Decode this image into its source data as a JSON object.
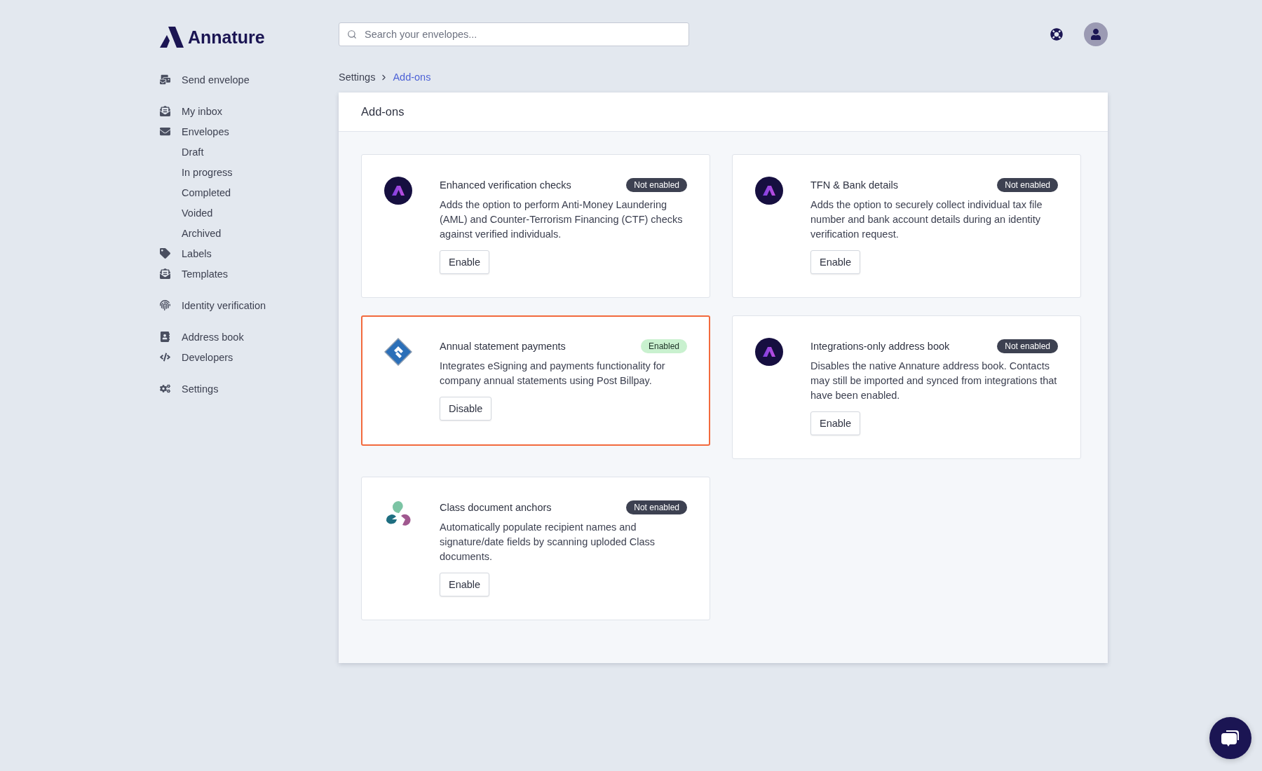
{
  "brand": {
    "name": "Annature"
  },
  "search": {
    "placeholder": "Search your envelopes..."
  },
  "sidebar": {
    "sections": [
      [
        {
          "kind": "send",
          "label": "Send envelope"
        }
      ],
      [
        {
          "kind": "inbox",
          "label": "My inbox"
        },
        {
          "kind": "envelope",
          "label": "Envelopes",
          "children": [
            {
              "label": "Draft"
            },
            {
              "label": "In progress"
            },
            {
              "label": "Completed"
            },
            {
              "label": "Voided"
            },
            {
              "label": "Archived"
            }
          ]
        },
        {
          "kind": "tag",
          "label": "Labels"
        },
        {
          "kind": "templates",
          "label": "Templates"
        }
      ],
      [
        {
          "kind": "fingerprint",
          "label": "Identity verification"
        }
      ],
      [
        {
          "kind": "addressbook",
          "label": "Address book"
        },
        {
          "kind": "code",
          "label": "Developers"
        }
      ],
      [
        {
          "kind": "settings",
          "label": "Settings"
        }
      ]
    ]
  },
  "breadcrumb": [
    {
      "label": "Settings",
      "current": false
    },
    {
      "label": "Add-ons",
      "current": true
    }
  ],
  "panel": {
    "title": "Add-ons",
    "addons": [
      {
        "kind": "annature",
        "title": "Enhanced verification checks",
        "status": "Not enabled",
        "enabled": false,
        "highlighted": false,
        "description": "Adds the option to perform Anti-Money Laundering (AML) and Counter-Terrorism Financing (CTF) checks against verified individuals.",
        "action": "Enable"
      },
      {
        "kind": "annature",
        "title": "TFN & Bank details",
        "status": "Not enabled",
        "enabled": false,
        "highlighted": false,
        "description": "Adds the option to securely collect individual tax file number and bank account details during an identity verification request.",
        "action": "Enable"
      },
      {
        "kind": "diamond",
        "title": "Annual statement payments",
        "status": "Enabled",
        "enabled": true,
        "highlighted": true,
        "description": "Integrates eSigning and payments functionality for company annual statements using Post Billpay.",
        "action": "Disable"
      },
      {
        "kind": "annature",
        "title": "Integrations-only address book",
        "status": "Not enabled",
        "enabled": false,
        "highlighted": false,
        "description": "Disables the native Annature address book. Contacts may still be imported and synced from integrations that have been enabled.",
        "action": "Enable"
      },
      {
        "kind": "class",
        "title": "Class document anchors",
        "status": "Not enabled",
        "enabled": false,
        "highlighted": false,
        "description": "Automatically populate recipient names and signature/date fields by scanning uploded Class documents.",
        "action": "Enable"
      }
    ]
  }
}
